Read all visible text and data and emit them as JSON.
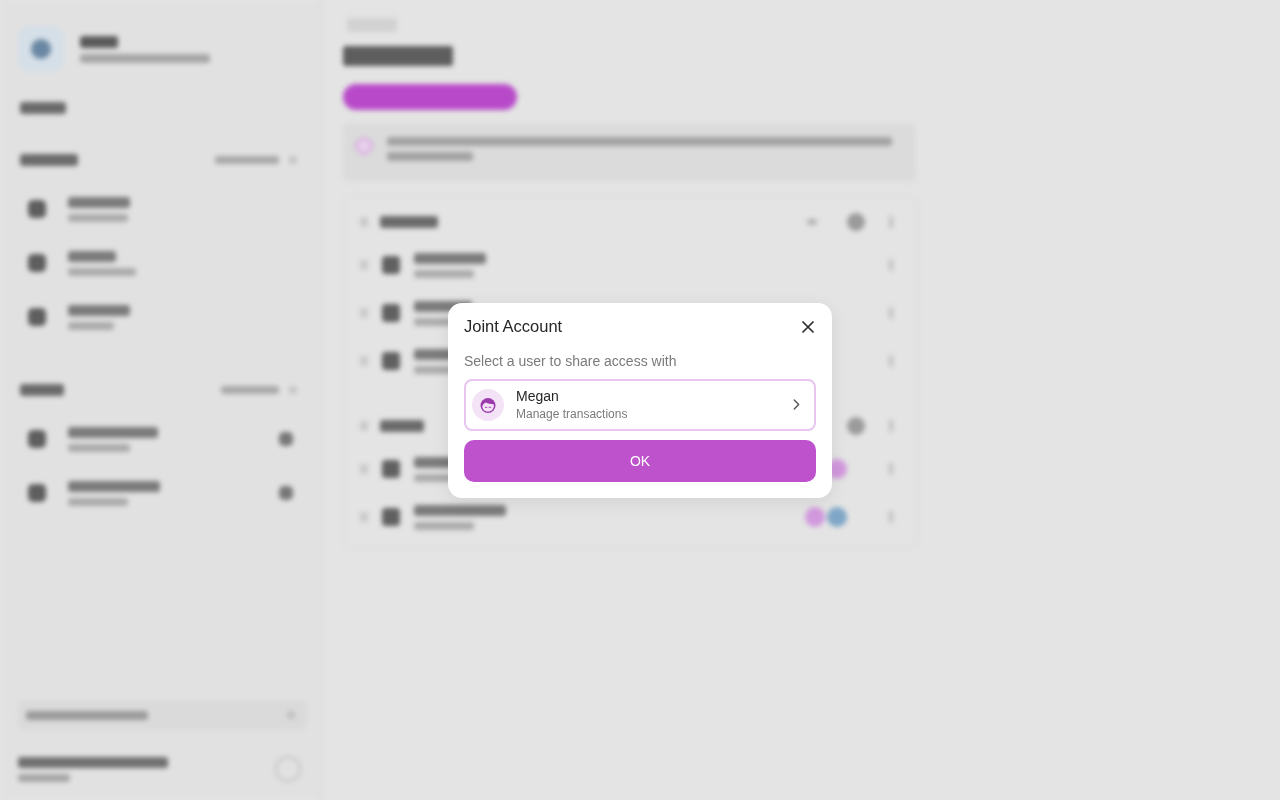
{
  "dialog": {
    "title": "Joint Account",
    "prompt": "Select a user to share access with",
    "users": [
      {
        "name": "Megan",
        "role": "Manage transactions",
        "selected": true
      }
    ],
    "ok_button": "OK"
  }
}
